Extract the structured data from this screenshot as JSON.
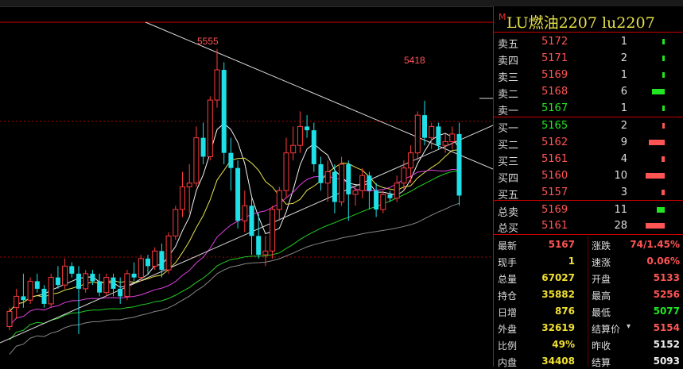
{
  "chart_data": {
    "type": "candlestick",
    "high_label": "5555",
    "recent_high_label": "5418",
    "candles": [
      [
        4820,
        4860,
        4810,
        4870
      ],
      [
        4870,
        4900,
        4840,
        4920
      ],
      [
        4900,
        4890,
        4870,
        4960
      ],
      [
        4890,
        4940,
        4880,
        4950
      ],
      [
        4940,
        4920,
        4910,
        4960
      ],
      [
        4920,
        4880,
        4870,
        4930
      ],
      [
        4880,
        4950,
        4870,
        4960
      ],
      [
        4950,
        4930,
        4920,
        4980
      ],
      [
        4930,
        4980,
        4920,
        5000
      ],
      [
        4980,
        4960,
        4950,
        4990
      ],
      [
        4960,
        4920,
        4800,
        4980
      ],
      [
        4920,
        4960,
        4910,
        4970
      ],
      [
        4960,
        4940,
        4930,
        4970
      ],
      [
        4940,
        4910,
        4900,
        4960
      ],
      [
        4910,
        4950,
        4900,
        4960
      ],
      [
        4950,
        4920,
        4900,
        4960
      ],
      [
        4920,
        4900,
        4880,
        4950
      ],
      [
        4900,
        4960,
        4890,
        4970
      ],
      [
        4960,
        4950,
        4940,
        4990
      ],
      [
        4950,
        5000,
        4940,
        5010
      ],
      [
        5000,
        4980,
        4960,
        5010
      ],
      [
        4980,
        5020,
        4970,
        5030
      ],
      [
        5020,
        4970,
        4950,
        5040
      ],
      [
        4970,
        5060,
        4960,
        5070
      ],
      [
        5060,
        5130,
        5050,
        5140
      ],
      [
        5130,
        5190,
        5110,
        5230
      ],
      [
        5190,
        5200,
        5120,
        5250
      ],
      [
        5200,
        5320,
        5190,
        5350
      ],
      [
        5320,
        5270,
        5250,
        5360
      ],
      [
        5270,
        5420,
        5260,
        5430
      ],
      [
        5420,
        5500,
        5400,
        5555
      ],
      [
        5500,
        5280,
        5250,
        5520
      ],
      [
        5280,
        5240,
        5180,
        5320
      ],
      [
        5240,
        5100,
        5080,
        5260
      ],
      [
        5100,
        5140,
        5070,
        5180
      ],
      [
        5140,
        5060,
        5010,
        5160
      ],
      [
        5060,
        5010,
        5000,
        5120
      ],
      [
        5010,
        5020,
        4980,
        5060
      ],
      [
        5020,
        5130,
        5000,
        5140
      ],
      [
        5130,
        5180,
        5100,
        5190
      ],
      [
        5180,
        5280,
        5160,
        5320
      ],
      [
        5280,
        5300,
        5260,
        5350
      ],
      [
        5300,
        5350,
        5280,
        5390
      ],
      [
        5350,
        5340,
        5320,
        5380
      ],
      [
        5340,
        5250,
        5230,
        5360
      ],
      [
        5250,
        5200,
        5180,
        5270
      ],
      [
        5200,
        5230,
        5150,
        5260
      ],
      [
        5230,
        5150,
        5120,
        5250
      ],
      [
        5150,
        5250,
        5140,
        5270
      ],
      [
        5250,
        5170,
        5100,
        5260
      ],
      [
        5170,
        5180,
        5140,
        5190
      ],
      [
        5180,
        5220,
        5160,
        5240
      ],
      [
        5220,
        5180,
        5130,
        5230
      ],
      [
        5180,
        5130,
        5110,
        5200
      ],
      [
        5130,
        5170,
        5120,
        5180
      ],
      [
        5170,
        5160,
        5150,
        5180
      ],
      [
        5160,
        5200,
        5150,
        5220
      ],
      [
        5200,
        5240,
        5180,
        5260
      ],
      [
        5240,
        5280,
        5200,
        5300
      ],
      [
        5280,
        5380,
        5260,
        5390
      ],
      [
        5380,
        5320,
        5300,
        5418
      ],
      [
        5320,
        5350,
        5290,
        5360
      ],
      [
        5350,
        5300,
        5290,
        5360
      ],
      [
        5300,
        5310,
        5280,
        5330
      ],
      [
        5310,
        5330,
        5290,
        5350
      ],
      [
        5330,
        5167,
        5140,
        5360
      ]
    ]
  },
  "panel": {
    "title_mark": "M",
    "title": "LU燃油2207  lu2207",
    "asks": [
      {
        "label": "卖五",
        "price": "5172",
        "vol": "1"
      },
      {
        "label": "卖四",
        "price": "5171",
        "vol": "2"
      },
      {
        "label": "卖三",
        "price": "5169",
        "vol": "1"
      },
      {
        "label": "卖二",
        "price": "5168",
        "vol": "6"
      },
      {
        "label": "卖一",
        "price": "5167",
        "vol": "1"
      }
    ],
    "bids": [
      {
        "label": "买一",
        "price": "5165",
        "vol": "2"
      },
      {
        "label": "买二",
        "price": "5162",
        "vol": "9"
      },
      {
        "label": "买三",
        "price": "5161",
        "vol": "4"
      },
      {
        "label": "买四",
        "price": "5160",
        "vol": "10"
      },
      {
        "label": "买五",
        "price": "5157",
        "vol": "3"
      }
    ],
    "totals": [
      {
        "label": "总卖",
        "price": "5169",
        "vol": "11"
      },
      {
        "label": "总买",
        "price": "5161",
        "vol": "28"
      }
    ],
    "quotes": [
      {
        "l1": "最新",
        "v1": "5167",
        "l2": "涨跌",
        "v2": "74/1.45%"
      },
      {
        "l1": "现手",
        "v1": "1",
        "l2": "速涨",
        "v2": "0.06%"
      },
      {
        "l1": "总量",
        "v1": "67027",
        "l2": "开盘",
        "v2": "5133"
      },
      {
        "l1": "持仓",
        "v1": "35882",
        "l2": "最高",
        "v2": "5256"
      },
      {
        "l1": "日增",
        "v1": "876",
        "l2": "最低",
        "v2": "5077"
      },
      {
        "l1": "外盘",
        "v1": "32619",
        "l2": "结算价",
        "v2": "5154"
      },
      {
        "l1": "比例",
        "v1": "49%",
        "l2": "昨收",
        "v2": "5152"
      },
      {
        "l1": "内盘",
        "v1": "34408",
        "l2": "结算",
        "v2": "5093"
      }
    ],
    "colors": {
      "up": "#ff5454",
      "down": "#22e622",
      "accent": "#f0e032"
    }
  }
}
